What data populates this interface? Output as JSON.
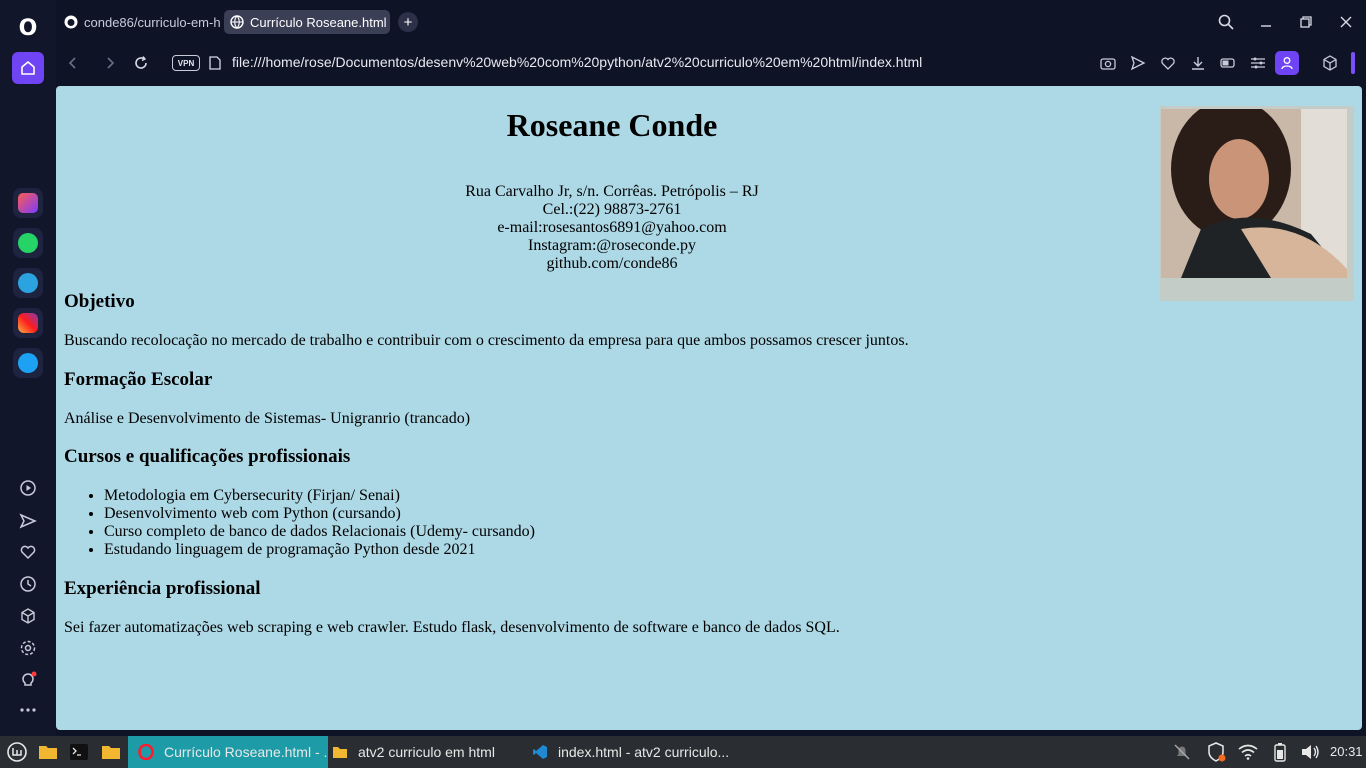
{
  "browser": {
    "tabs": [
      {
        "label": "conde86/curriculo-em-h",
        "icon": "github-icon"
      },
      {
        "label": "Currículo Roseane.html",
        "icon": "globe-icon"
      }
    ],
    "new_tab_label": "+",
    "vpn_label": "VPN",
    "url": "file:///home/rose/Documentos/desenv%20web%20com%20python/atv2%20curriculo%20em%20html/index.html",
    "accent_color": "#6f44f5"
  },
  "sidebar": {
    "logo": "O",
    "apps": [
      "aria-icon",
      "whatsapp-icon",
      "telegram-icon",
      "instagram-icon",
      "twitter-icon"
    ],
    "tools": [
      "player-icon",
      "send-icon",
      "heart-icon",
      "history-icon",
      "cube-icon",
      "settings-icon",
      "lightbulb-icon",
      "more-icon"
    ]
  },
  "resume": {
    "name": "Roseane Conde",
    "contact": [
      "Rua Carvalho Jr, s/n. Corrêas. Petrópolis – RJ",
      "Cel.:(22) 98873-2761",
      "e-mail:rosesantos6891@yahoo.com",
      "Instagram:@roseconde.py",
      "github.com/conde86"
    ],
    "sections": {
      "objective": {
        "title": "Objetivo",
        "text": "Buscando recolocação no mercado de trabalho e contribuir com o crescimento da empresa para que ambos possamos crescer juntos."
      },
      "education": {
        "title": "Formação Escolar",
        "text": "Análise e Desenvolvimento de Sistemas- Unigranrio (trancado)"
      },
      "courses": {
        "title": "Cursos e qualificações profissionais",
        "items": [
          "Metodologia em Cybersecurity (Firjan/ Senai)",
          "Desenvolvimento web com Python (cursando)",
          "Curso completo de banco de dados Relacionais (Udemy- cursando)",
          "Estudando linguagem de programação Python desde 2021"
        ]
      },
      "experience": {
        "title": "Experiência profissional",
        "text": "Sei fazer automatizações web scraping e web crawler. Estudo flask, desenvolvimento de software e banco de dados SQL."
      }
    },
    "background_color": "#add8e6"
  },
  "taskbar": {
    "tasks": [
      {
        "label": "Currículo Roseane.html - ...",
        "icon": "opera-icon"
      },
      {
        "label": "atv2 curriculo em html",
        "icon": "folder-icon"
      },
      {
        "label": "index.html - atv2 curriculo...",
        "icon": "vscode-icon"
      }
    ],
    "clock": "20:31"
  }
}
